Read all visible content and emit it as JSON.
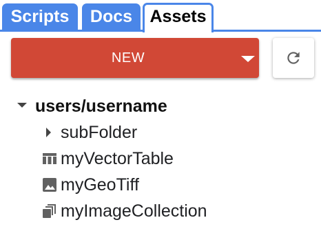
{
  "tabs": [
    {
      "label": "Scripts",
      "active": false
    },
    {
      "label": "Docs",
      "active": false
    },
    {
      "label": "Assets",
      "active": true
    }
  ],
  "toolbar": {
    "new_label": "NEW",
    "new_icon": "caret-down-icon",
    "refresh_icon": "refresh-icon"
  },
  "tree": {
    "root": {
      "label": "users/username",
      "icon": "caret-down-icon",
      "expanded": true
    },
    "items": [
      {
        "label": "subFolder",
        "icon": "caret-right-icon",
        "kind": "folder"
      },
      {
        "label": "myVectorTable",
        "icon": "table-icon",
        "kind": "table"
      },
      {
        "label": "myGeoTiff",
        "icon": "image-icon",
        "kind": "image"
      },
      {
        "label": "myImageCollection",
        "icon": "image-collection-icon",
        "kind": "image-collection"
      }
    ]
  },
  "colors": {
    "tab_blue": "#4a86e8",
    "new_button_red": "#d14836",
    "icon_gray": "#616161",
    "text": "#202124"
  }
}
